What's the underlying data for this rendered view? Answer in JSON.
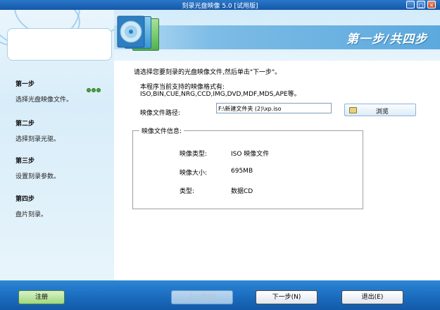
{
  "window": {
    "title": "刻录光盘映像 5.0 [试用版]",
    "controls": [
      "minimize",
      "maximize",
      "close"
    ]
  },
  "header": {
    "banner_text": "第一步/共四步"
  },
  "steps": [
    {
      "title": "第一步",
      "desc": "选择光盘映像文件。",
      "active": true
    },
    {
      "title": "第二步",
      "desc": "选择刻录光驱。"
    },
    {
      "title": "第三步",
      "desc": "设置刻录参数。"
    },
    {
      "title": "第四步",
      "desc": "盘片刻录。"
    }
  ],
  "main": {
    "instruction": "请选择您要刻录的光盘映像文件,然后单击\"下一步\"。",
    "supported_title": "本程序当前支持的映像格式有:",
    "supported_formats": "ISO,BIN,CUE,NRG,CCD,IMG,DVD,MDF,MDS,APE等。",
    "path_label": "映像文件路径:",
    "path_value": "F:\\新建文件夹 (2)\\xp.iso",
    "browse_label": "浏览",
    "info_group_title": "映像文件信息:",
    "info": [
      {
        "label": "映像类型:",
        "value": "ISO 映像文件"
      },
      {
        "label": "映像大小:",
        "value": "695MB"
      },
      {
        "label": "类型:",
        "value": "数据CD"
      }
    ]
  },
  "footer": {
    "register": "注册",
    "prev": "上一步(B)",
    "next": "下一步(N)",
    "exit": "退出(E)"
  },
  "colors": {
    "title_bar": "#1557a9",
    "bottom_bar": "#1a6cbf",
    "banner": "#5ca9dd",
    "active_indicator": "#49a23a"
  }
}
